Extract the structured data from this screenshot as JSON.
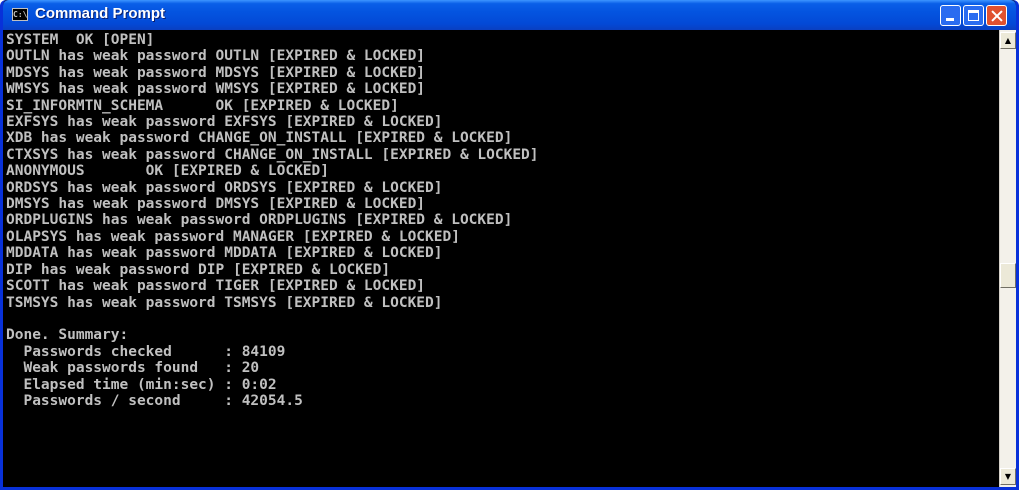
{
  "window": {
    "title": "Command Prompt",
    "icon_text": "C:\\"
  },
  "console": {
    "lines": [
      "SYSTEM  OK [OPEN]",
      "OUTLN has weak password OUTLN [EXPIRED & LOCKED]",
      "MDSYS has weak password MDSYS [EXPIRED & LOCKED]",
      "WMSYS has weak password WMSYS [EXPIRED & LOCKED]",
      "SI_INFORMTN_SCHEMA      OK [EXPIRED & LOCKED]",
      "EXFSYS has weak password EXFSYS [EXPIRED & LOCKED]",
      "XDB has weak password CHANGE_ON_INSTALL [EXPIRED & LOCKED]",
      "CTXSYS has weak password CHANGE_ON_INSTALL [EXPIRED & LOCKED]",
      "ANONYMOUS       OK [EXPIRED & LOCKED]",
      "ORDSYS has weak password ORDSYS [EXPIRED & LOCKED]",
      "DMSYS has weak password DMSYS [EXPIRED & LOCKED]",
      "ORDPLUGINS has weak password ORDPLUGINS [EXPIRED & LOCKED]",
      "OLAPSYS has weak password MANAGER [EXPIRED & LOCKED]",
      "MDDATA has weak password MDDATA [EXPIRED & LOCKED]",
      "DIP has weak password DIP [EXPIRED & LOCKED]",
      "SCOTT has weak password TIGER [EXPIRED & LOCKED]",
      "TSMSYS has weak password TSMSYS [EXPIRED & LOCKED]",
      "",
      "Done. Summary:",
      "  Passwords checked      : 84109",
      "  Weak passwords found   : 20",
      "  Elapsed time (min:sec) : 0:02",
      "  Passwords / second     : 42054.5"
    ]
  },
  "colors": {
    "titlebar": "#0454e0",
    "console_bg": "#000000",
    "console_text": "#c0c0c0",
    "close_button": "#e0512f"
  },
  "icons": {
    "window_icon": "cmd-icon",
    "minimize": "minimize-icon",
    "maximize": "maximize-icon",
    "close": "close-icon",
    "scroll_up": "scroll-up-arrow-icon",
    "scroll_down": "scroll-down-arrow-icon"
  }
}
